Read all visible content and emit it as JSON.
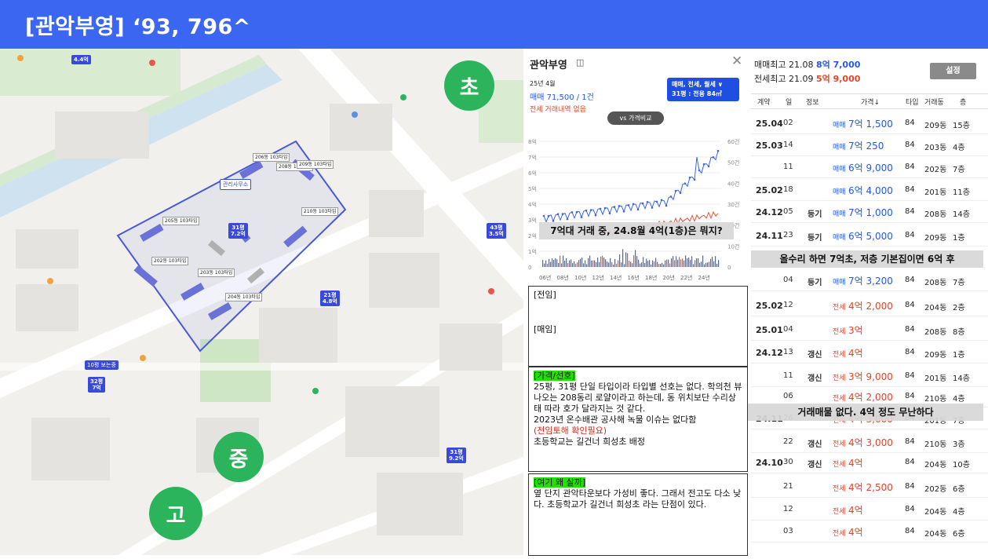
{
  "banner": {
    "title": "[관악부영] ‘93, 796^"
  },
  "map": {
    "schools": [
      "초",
      "중",
      "고"
    ],
    "buildings": [
      "206동\n103타입",
      "208동\n103타입",
      "209동\n103타입",
      "205동\n103타입",
      "202동\n103타입",
      "203동\n103타입",
      "204동\n103타입",
      "210동\n103타입"
    ],
    "price_pins": [
      "31평\n7.2억",
      "21평\n4.8억",
      "43평\n3.5억",
      "31평\n9.2억",
      "32평\n7억",
      "4.4억"
    ],
    "management_office": "관리사무소",
    "tags": [
      "10평 보는중"
    ],
    "labels": [
      "관악부영",
      "은천파크",
      "일성초",
      "주차장",
      "관악부영"
    ]
  },
  "detail": {
    "title": "관악부영",
    "title_icon": "◫",
    "close": "✕",
    "date": "25년 4월",
    "sale": "매매 71,500 / 1건",
    "jeonse": "전세 거래내역 없음",
    "dropdown_line1": "매매, 전세, 월세 ∨",
    "dropdown_line2": "31평 : 전용 84㎡",
    "vs_button": "vs 가격비교",
    "chart": {
      "left_ticks": [
        "8억",
        "7억",
        "6억",
        "5억",
        "4억",
        "3억",
        "2억",
        "1억",
        "0"
      ],
      "right_ticks": [
        "60건",
        "50건",
        "40건",
        "30건",
        "20건",
        "10건",
        "0"
      ],
      "x_ticks": [
        "06년",
        "08년",
        "10년",
        "12년",
        "14년",
        "16년",
        "18년",
        "20년",
        "22년",
        "24년"
      ]
    }
  },
  "caption_chart": "7억대 거래 중, 24.8월 4억(1층)은 뭐지?",
  "caption_mid": "올수리 하면 7억초, 저층 기본집이면 6억 후",
  "caption_bottom": "거래매물 없다. 4억 정도 무난하다",
  "notes": {
    "jeonim": "[전임]",
    "maeim": "[매임]",
    "price_head": "[가격/선호]",
    "price_body1": "25평, 31평 단일 타입이라 타입별 선호는 없다. 학의천 뷰 나오는 208동리 로얄이라고 하는데, 동 위치보단 수리상태 따라 호가 달라지는 것 같다.",
    "price_body2": "2023년 온수배관 공사해 녹물 이슈는 없다함",
    "price_red": "(전임토해 확인필요)",
    "price_body3": "초등학교는 길건너 희성초 배정",
    "why_head": "[여기 왜 살까]",
    "why_body": "옆 단지 관악타운보다 가성비 좋다. 그래서 전고도 다소 낮다. 초등학교가 길건너 희성초 라는 단점이 있다."
  },
  "table": {
    "max_sale_label": "매매최고",
    "max_sale_date": "21.08",
    "max_sale_value": "8억 7,000",
    "max_rent_label": "전세최고",
    "max_rent_date": "21.09",
    "max_rent_value": "5억 9,000",
    "settings": "설정",
    "headers": [
      "계약",
      "일",
      "정보",
      "가격↓",
      "타입",
      "거래동",
      "층"
    ],
    "rows": [
      {
        "contract": "25.04",
        "day": "02",
        "info": "",
        "kind": "매매",
        "price": "7억 1,500",
        "type": "84",
        "dong": "209동",
        "floor": "15층"
      },
      {
        "contract": "25.03",
        "day": "14",
        "info": "",
        "kind": "매매",
        "price": "7억 250",
        "type": "84",
        "dong": "203동",
        "floor": "4층"
      },
      {
        "contract": "",
        "day": "11",
        "info": "",
        "kind": "매매",
        "price": "6억 9,000",
        "type": "84",
        "dong": "202동",
        "floor": "7층"
      },
      {
        "contract": "25.02",
        "day": "18",
        "info": "",
        "kind": "매매",
        "price": "6억 4,000",
        "type": "84",
        "dong": "201동",
        "floor": "11층"
      },
      {
        "contract": "24.12",
        "day": "05",
        "info": "등기",
        "kind": "매매",
        "price": "7억 1,000",
        "type": "84",
        "dong": "208동",
        "floor": "14층"
      },
      {
        "contract": "24.11",
        "day": "23",
        "info": "등기",
        "kind": "매매",
        "price": "6억 5,000",
        "type": "84",
        "dong": "209동",
        "floor": "1층"
      },
      {
        "contract": "",
        "day": "04",
        "info": "등기",
        "kind": "매매",
        "price": "7억 3,200",
        "type": "84",
        "dong": "208동",
        "floor": "7층"
      },
      {
        "contract": "25.02",
        "day": "12",
        "info": "",
        "kind": "전세",
        "price": "4억 2,000",
        "type": "84",
        "dong": "204동",
        "floor": "2층"
      },
      {
        "contract": "25.01",
        "day": "04",
        "info": "",
        "kind": "전세",
        "price": "3억",
        "type": "84",
        "dong": "208동",
        "floor": "8층"
      },
      {
        "contract": "24.12",
        "day": "13",
        "info": "갱신",
        "kind": "전세",
        "price": "4억",
        "type": "84",
        "dong": "209동",
        "floor": "1층"
      },
      {
        "contract": "",
        "day": "11",
        "info": "갱신",
        "kind": "전세",
        "price": "3억 9,000",
        "type": "84",
        "dong": "201동",
        "floor": "14층"
      },
      {
        "contract": "",
        "day": "06",
        "info": "",
        "kind": "전세",
        "price": "4억 2,000",
        "type": "84",
        "dong": "210동",
        "floor": "4층"
      },
      {
        "contract": "24.11",
        "day": "26",
        "info": "",
        "kind": "전세",
        "price": "4억 3,000",
        "type": "84",
        "dong": "201동",
        "floor": "7층"
      },
      {
        "contract": "",
        "day": "22",
        "info": "갱신",
        "kind": "전세",
        "price": "4억 3,000",
        "type": "84",
        "dong": "210동",
        "floor": "3층"
      },
      {
        "contract": "24.10",
        "day": "30",
        "info": "갱신",
        "kind": "전세",
        "price": "4억",
        "type": "84",
        "dong": "204동",
        "floor": "10층"
      },
      {
        "contract": "",
        "day": "21",
        "info": "",
        "kind": "전세",
        "price": "4억 2,500",
        "type": "84",
        "dong": "202동",
        "floor": "6층"
      },
      {
        "contract": "",
        "day": "12",
        "info": "",
        "kind": "전세",
        "price": "4억",
        "type": "84",
        "dong": "204동",
        "floor": "4층"
      },
      {
        "contract": "",
        "day": "03",
        "info": "",
        "kind": "전세",
        "price": "4억",
        "type": "84",
        "dong": "204동",
        "floor": "6층"
      }
    ]
  }
}
